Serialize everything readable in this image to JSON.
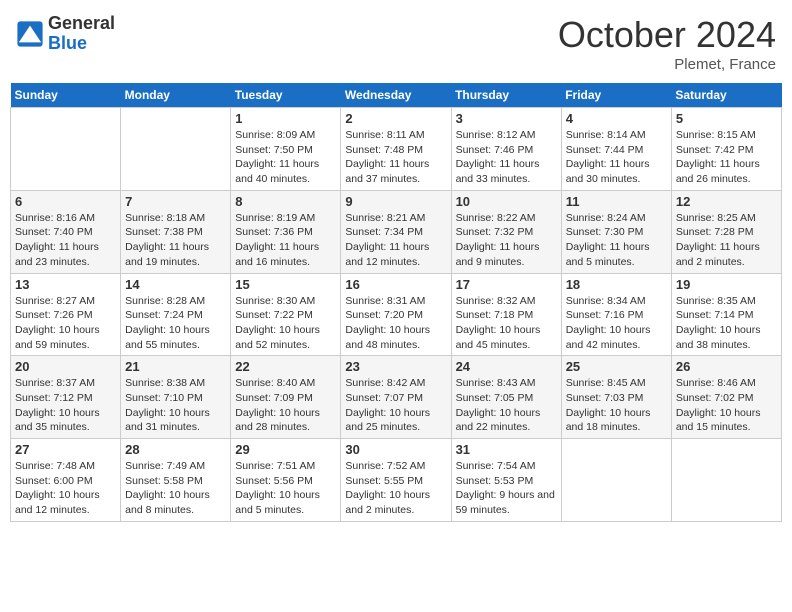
{
  "header": {
    "logo_general": "General",
    "logo_blue": "Blue",
    "month": "October 2024",
    "location": "Plemet, France"
  },
  "weekdays": [
    "Sunday",
    "Monday",
    "Tuesday",
    "Wednesday",
    "Thursday",
    "Friday",
    "Saturday"
  ],
  "weeks": [
    [
      {
        "day": "",
        "info": ""
      },
      {
        "day": "",
        "info": ""
      },
      {
        "day": "1",
        "info": "Sunrise: 8:09 AM\nSunset: 7:50 PM\nDaylight: 11 hours and 40 minutes."
      },
      {
        "day": "2",
        "info": "Sunrise: 8:11 AM\nSunset: 7:48 PM\nDaylight: 11 hours and 37 minutes."
      },
      {
        "day": "3",
        "info": "Sunrise: 8:12 AM\nSunset: 7:46 PM\nDaylight: 11 hours and 33 minutes."
      },
      {
        "day": "4",
        "info": "Sunrise: 8:14 AM\nSunset: 7:44 PM\nDaylight: 11 hours and 30 minutes."
      },
      {
        "day": "5",
        "info": "Sunrise: 8:15 AM\nSunset: 7:42 PM\nDaylight: 11 hours and 26 minutes."
      }
    ],
    [
      {
        "day": "6",
        "info": "Sunrise: 8:16 AM\nSunset: 7:40 PM\nDaylight: 11 hours and 23 minutes."
      },
      {
        "day": "7",
        "info": "Sunrise: 8:18 AM\nSunset: 7:38 PM\nDaylight: 11 hours and 19 minutes."
      },
      {
        "day": "8",
        "info": "Sunrise: 8:19 AM\nSunset: 7:36 PM\nDaylight: 11 hours and 16 minutes."
      },
      {
        "day": "9",
        "info": "Sunrise: 8:21 AM\nSunset: 7:34 PM\nDaylight: 11 hours and 12 minutes."
      },
      {
        "day": "10",
        "info": "Sunrise: 8:22 AM\nSunset: 7:32 PM\nDaylight: 11 hours and 9 minutes."
      },
      {
        "day": "11",
        "info": "Sunrise: 8:24 AM\nSunset: 7:30 PM\nDaylight: 11 hours and 5 minutes."
      },
      {
        "day": "12",
        "info": "Sunrise: 8:25 AM\nSunset: 7:28 PM\nDaylight: 11 hours and 2 minutes."
      }
    ],
    [
      {
        "day": "13",
        "info": "Sunrise: 8:27 AM\nSunset: 7:26 PM\nDaylight: 10 hours and 59 minutes."
      },
      {
        "day": "14",
        "info": "Sunrise: 8:28 AM\nSunset: 7:24 PM\nDaylight: 10 hours and 55 minutes."
      },
      {
        "day": "15",
        "info": "Sunrise: 8:30 AM\nSunset: 7:22 PM\nDaylight: 10 hours and 52 minutes."
      },
      {
        "day": "16",
        "info": "Sunrise: 8:31 AM\nSunset: 7:20 PM\nDaylight: 10 hours and 48 minutes."
      },
      {
        "day": "17",
        "info": "Sunrise: 8:32 AM\nSunset: 7:18 PM\nDaylight: 10 hours and 45 minutes."
      },
      {
        "day": "18",
        "info": "Sunrise: 8:34 AM\nSunset: 7:16 PM\nDaylight: 10 hours and 42 minutes."
      },
      {
        "day": "19",
        "info": "Sunrise: 8:35 AM\nSunset: 7:14 PM\nDaylight: 10 hours and 38 minutes."
      }
    ],
    [
      {
        "day": "20",
        "info": "Sunrise: 8:37 AM\nSunset: 7:12 PM\nDaylight: 10 hours and 35 minutes."
      },
      {
        "day": "21",
        "info": "Sunrise: 8:38 AM\nSunset: 7:10 PM\nDaylight: 10 hours and 31 minutes."
      },
      {
        "day": "22",
        "info": "Sunrise: 8:40 AM\nSunset: 7:09 PM\nDaylight: 10 hours and 28 minutes."
      },
      {
        "day": "23",
        "info": "Sunrise: 8:42 AM\nSunset: 7:07 PM\nDaylight: 10 hours and 25 minutes."
      },
      {
        "day": "24",
        "info": "Sunrise: 8:43 AM\nSunset: 7:05 PM\nDaylight: 10 hours and 22 minutes."
      },
      {
        "day": "25",
        "info": "Sunrise: 8:45 AM\nSunset: 7:03 PM\nDaylight: 10 hours and 18 minutes."
      },
      {
        "day": "26",
        "info": "Sunrise: 8:46 AM\nSunset: 7:02 PM\nDaylight: 10 hours and 15 minutes."
      }
    ],
    [
      {
        "day": "27",
        "info": "Sunrise: 7:48 AM\nSunset: 6:00 PM\nDaylight: 10 hours and 12 minutes."
      },
      {
        "day": "28",
        "info": "Sunrise: 7:49 AM\nSunset: 5:58 PM\nDaylight: 10 hours and 8 minutes."
      },
      {
        "day": "29",
        "info": "Sunrise: 7:51 AM\nSunset: 5:56 PM\nDaylight: 10 hours and 5 minutes."
      },
      {
        "day": "30",
        "info": "Sunrise: 7:52 AM\nSunset: 5:55 PM\nDaylight: 10 hours and 2 minutes."
      },
      {
        "day": "31",
        "info": "Sunrise: 7:54 AM\nSunset: 5:53 PM\nDaylight: 9 hours and 59 minutes."
      },
      {
        "day": "",
        "info": ""
      },
      {
        "day": "",
        "info": ""
      }
    ]
  ]
}
